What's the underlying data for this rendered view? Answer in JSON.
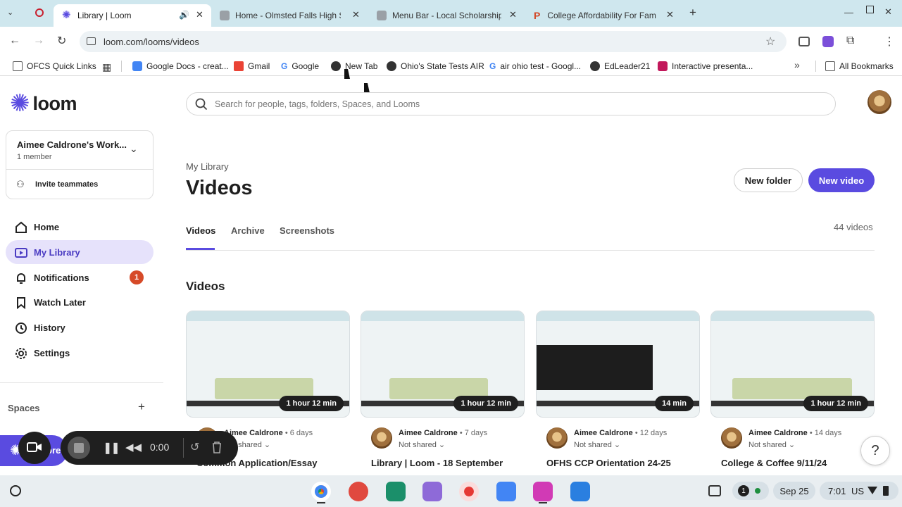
{
  "browser": {
    "tabs": [
      {
        "title": "Library | Loom",
        "active": true
      },
      {
        "title": "Home - Olmsted Falls High Sch"
      },
      {
        "title": "Menu Bar - Local Scholarship P"
      },
      {
        "title": "College Affordability For Famil"
      }
    ],
    "url": "loom.com/looms/videos",
    "bookmarks": [
      "OFCS Quick Links",
      "Google Docs - creat...",
      "Gmail",
      "Google",
      "New Tab",
      "Ohio's State Tests AIR",
      "air ohio test - Googl...",
      "EdLeader21",
      "Interactive presenta..."
    ],
    "all_bookmarks": "All Bookmarks"
  },
  "loom": {
    "logo_text": "loom",
    "search_placeholder": "Search for people, tags, folders, Spaces, and Looms",
    "workspace": {
      "name": "Aimee Caldrone's Work...",
      "members": "1 member"
    },
    "invite": "Invite teammates",
    "nav": [
      {
        "label": "Home"
      },
      {
        "label": "My Library"
      },
      {
        "label": "Notifications",
        "badge": "1"
      },
      {
        "label": "Watch Later"
      },
      {
        "label": "History"
      },
      {
        "label": "Settings"
      }
    ],
    "spaces_label": "Spaces",
    "breadcrumb": "My Library",
    "page_title": "Videos",
    "new_folder": "New folder",
    "new_video": "New video",
    "tabs": [
      "Videos",
      "Archive",
      "Screenshots"
    ],
    "video_count": "44 videos",
    "section_title": "Videos",
    "videos": [
      {
        "duration": "1 hour 12 min",
        "author": "Aimee Caldrone",
        "days": "• 6 days",
        "shared": "Not shared",
        "title": "Common Application/Essay"
      },
      {
        "duration": "1 hour 12 min",
        "author": "Aimee Caldrone",
        "days": "• 7 days",
        "shared": "Not shared",
        "title": "Library | Loom - 18 September"
      },
      {
        "duration": "14 min",
        "author": "Aimee Caldrone",
        "days": "• 12 days",
        "shared": "Not shared",
        "title": "OFHS CCP Orientation 24-25"
      },
      {
        "duration": "1 hour 12 min",
        "author": "Aimee Caldrone",
        "days": "• 14 days",
        "shared": "Not shared",
        "title": "College & Coffee 9/11/24"
      }
    ],
    "recorder": {
      "time": "0:00",
      "label": "ore"
    },
    "help": "?"
  },
  "shelf": {
    "date": "Sep 25",
    "time": "7:01",
    "locale": "US",
    "notif_count": "1"
  },
  "colors": {
    "accent": "#5a4be0",
    "selected_bg": "#e6e2fb",
    "badge": "#d64a28",
    "tabstrip": "#cfe7ee"
  }
}
